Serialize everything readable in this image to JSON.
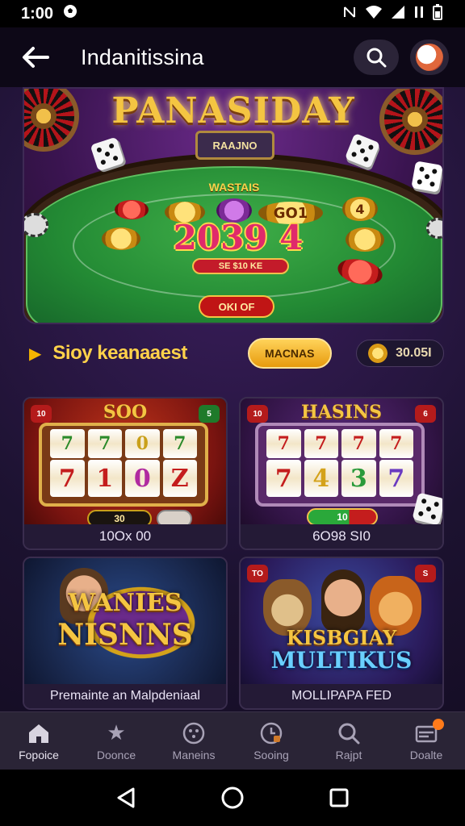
{
  "status_bar": {
    "time": "1:00"
  },
  "app_bar": {
    "title": "Indanitissina"
  },
  "hero": {
    "title": "PANASIDAY",
    "dealer_plate": "RAAJNO",
    "felt_label": "WASTAIS",
    "big_number": "2039 4",
    "felt_pill": "SE $10 KE",
    "button_label": "OKI OF",
    "chip_labels": [
      "GO1",
      "4"
    ]
  },
  "section": {
    "title": "Sioy keanaaest",
    "button_label": "MACNAS",
    "coins": "30.05I"
  },
  "cards": [
    {
      "title": "SOO",
      "badge_left": "10",
      "badge_right": "5",
      "reels_top": [
        "7",
        "7",
        "0",
        "7"
      ],
      "reels_mid": [
        "7",
        "1",
        "0",
        "Z"
      ],
      "bet_pill": "30",
      "caption": "10Ox 00"
    },
    {
      "title": "HASINS",
      "badge_left": "10",
      "badge_right": "6",
      "reels_top": [
        "7",
        "7",
        "7",
        "7"
      ],
      "reels_mid": [
        "7",
        "4",
        "3",
        "7"
      ],
      "bet_pill": "10",
      "caption": "6O98 SI0"
    },
    {
      "title_line1": "WANIES",
      "title_line2": "NISNNS",
      "caption": "Premainte an Malpdeniaal"
    },
    {
      "badge_left": "TO",
      "badge_right": "S",
      "title_line1": "KISBGIAY",
      "title_line2": "MULTIKUS",
      "caption": "MOLLIPAPA FED"
    }
  ],
  "bottom_nav": {
    "items": [
      {
        "label": "Fopoice",
        "icon": "home-icon"
      },
      {
        "label": "Doonce",
        "icon": "star-icon"
      },
      {
        "label": "Maneins",
        "icon": "dice-icon"
      },
      {
        "label": "Sooing",
        "icon": "clock-icon"
      },
      {
        "label": "Rajpt",
        "icon": "search-icon"
      },
      {
        "label": "Doalte",
        "icon": "wallet-icon"
      }
    ]
  },
  "colors": {
    "accent_gold": "#f4c542",
    "background": "#1c1230",
    "nav_background": "#2a2436"
  }
}
